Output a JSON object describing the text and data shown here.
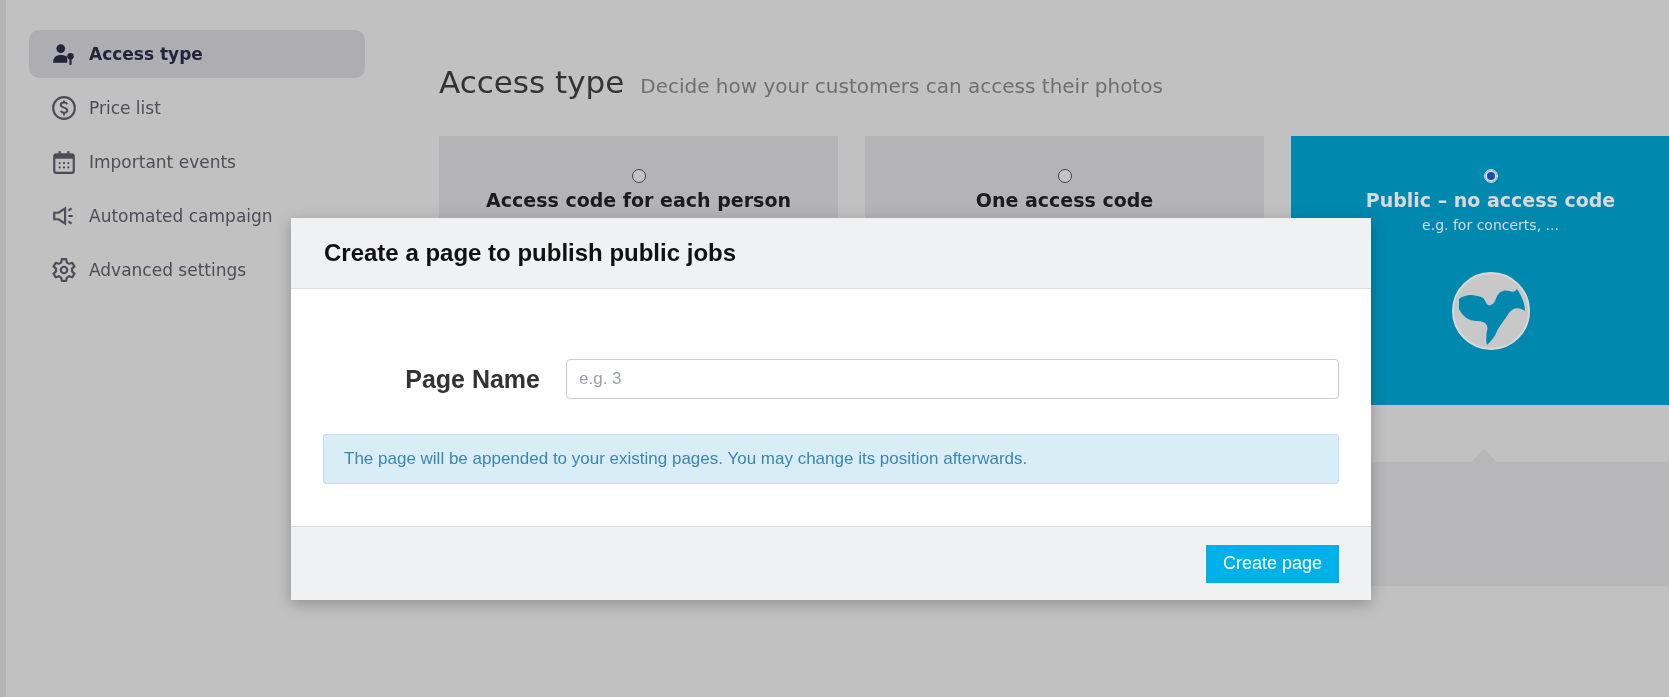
{
  "sidebar": {
    "items": [
      {
        "label": "Access type",
        "selected": true
      },
      {
        "label": "Price list",
        "selected": false
      },
      {
        "label": "Important events",
        "selected": false
      },
      {
        "label": "Automated campaign",
        "selected": false
      },
      {
        "label": "Advanced settings",
        "selected": false
      }
    ]
  },
  "header": {
    "title": "Access type",
    "subtitle": "Decide how your customers can access their photos"
  },
  "options": [
    {
      "title": "Access code for each person",
      "selected": false
    },
    {
      "title": "One access code",
      "selected": false
    },
    {
      "title": "Public – no access code",
      "description": "e.g. for concerts, ...",
      "selected": true
    }
  ],
  "dialog": {
    "title": "Create a page to publish public jobs",
    "field": {
      "label": "Page Name",
      "placeholder": "e.g. 3"
    },
    "info": "The page will be appended to your existing pages. You may change its position afterwards.",
    "button": "Create page"
  }
}
